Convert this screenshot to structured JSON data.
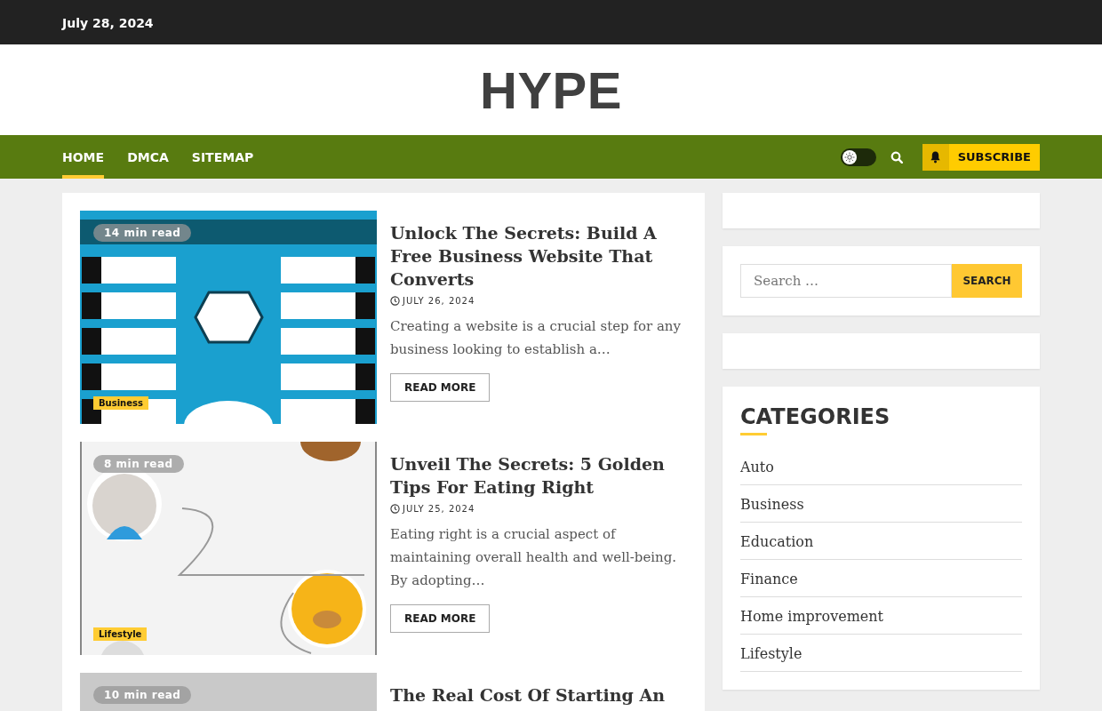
{
  "top_bar": {
    "date": "July 28, 2024"
  },
  "site": {
    "title": "HYPE"
  },
  "nav": {
    "items": [
      {
        "label": "HOME",
        "selected": true
      },
      {
        "label": "DMCA",
        "selected": false
      },
      {
        "label": "SITEMAP",
        "selected": false
      }
    ],
    "dark_mode": false,
    "subscribe": "SUBSCRIBE"
  },
  "posts": [
    {
      "title": "Unlock The Secrets: Build A Free Business Website That Converts",
      "read_time": "14 min read",
      "category": "Business",
      "date": "JULY 26, 2024",
      "excerpt": "Creating a website is a crucial step for any business looking to establish a…",
      "button": "READ MORE"
    },
    {
      "title": "Unveil The Secrets: 5 Golden Tips For Eating Right",
      "read_time": "8 min read",
      "category": "Lifestyle",
      "date": "JULY 25, 2024",
      "excerpt": "Eating right is a crucial aspect of maintaining overall health and well-being. By adopting…",
      "button": "READ MORE"
    },
    {
      "title": "The Real Cost Of Starting An",
      "read_time": "10 min read"
    }
  ],
  "sidebar": {
    "search": {
      "placeholder": "Search …",
      "button": "SEARCH"
    },
    "categories": {
      "title": "CATEGORIES",
      "items": [
        "Auto",
        "Business",
        "Education",
        "Finance",
        "Home improvement",
        "Lifestyle"
      ]
    }
  }
}
